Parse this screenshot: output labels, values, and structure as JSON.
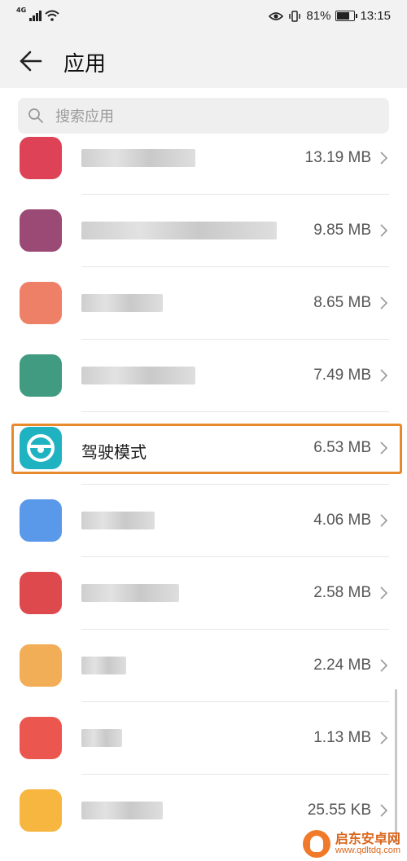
{
  "status_bar": {
    "network": "4G",
    "battery_percent": "81%",
    "battery_level": 0.81,
    "time": "13:15"
  },
  "header": {
    "title": "应用",
    "back_icon": "arrow-left-icon"
  },
  "search": {
    "placeholder": "搜索应用",
    "value": "",
    "icon": "search-icon"
  },
  "apps": [
    {
      "name": "",
      "size": "13.19 MB",
      "icon_color": "#d7213a",
      "redacted": true
    },
    {
      "name": "",
      "size": "9.85 MB",
      "icon_color": "#8a2a5e",
      "redacted": true
    },
    {
      "name": "",
      "size": "8.65 MB",
      "icon_color": "#ec6a4d",
      "redacted": true
    },
    {
      "name": "",
      "size": "7.49 MB",
      "icon_color": "#1f8a6b",
      "redacted": true
    },
    {
      "name": "驾驶模式",
      "size": "6.53 MB",
      "icon_color": "#1fb3c2",
      "redacted": false,
      "highlighted": true
    },
    {
      "name": "",
      "size": "4.06 MB",
      "icon_color": "#3d86e6",
      "redacted": true
    },
    {
      "name": "",
      "size": "2.58 MB",
      "icon_color": "#d8292e",
      "redacted": true
    },
    {
      "name": "",
      "size": "2.24 MB",
      "icon_color": "#f0a03a",
      "redacted": true
    },
    {
      "name": "",
      "size": "1.13 MB",
      "icon_color": "#e8382f",
      "redacted": true
    },
    {
      "name": "",
      "size": "25.55 KB",
      "icon_color": "#f4a91f",
      "redacted": true
    }
  ],
  "highlight_color": "#e8892b",
  "watermark": {
    "name": "启东安卓网",
    "url": "www.qdltdq.com"
  }
}
